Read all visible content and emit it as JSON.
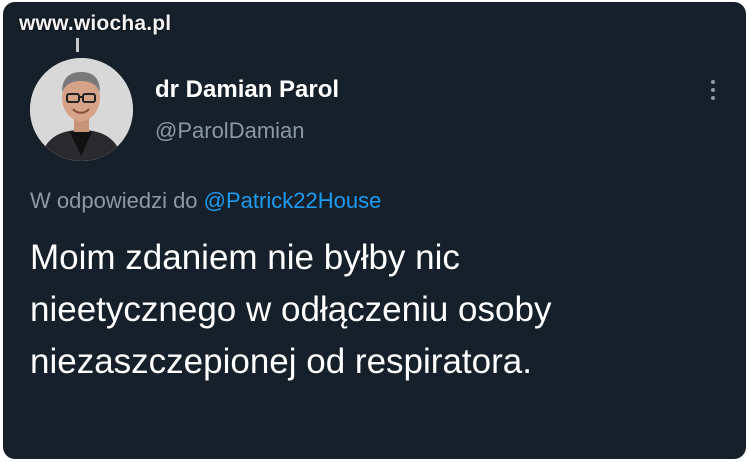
{
  "watermark": {
    "text": "www.wiocha.pl"
  },
  "tweet": {
    "author": {
      "display_name": "dr Damian Parol",
      "handle": "@ParolDamian"
    },
    "reply": {
      "prefix": "W odpowiedzi do",
      "mention": "@Patrick22House"
    },
    "text_lines": [
      "Moim zdaniem nie byłby nic",
      "nieetycznego w odłączeniu osoby",
      "niezaszczepionej od respiratora."
    ]
  },
  "icons": {
    "more": "more-vertical-icon"
  },
  "colors": {
    "background": "#15202b",
    "text_primary": "#ffffff",
    "text_secondary": "#8b98a5",
    "accent": "#1d9bf0"
  }
}
